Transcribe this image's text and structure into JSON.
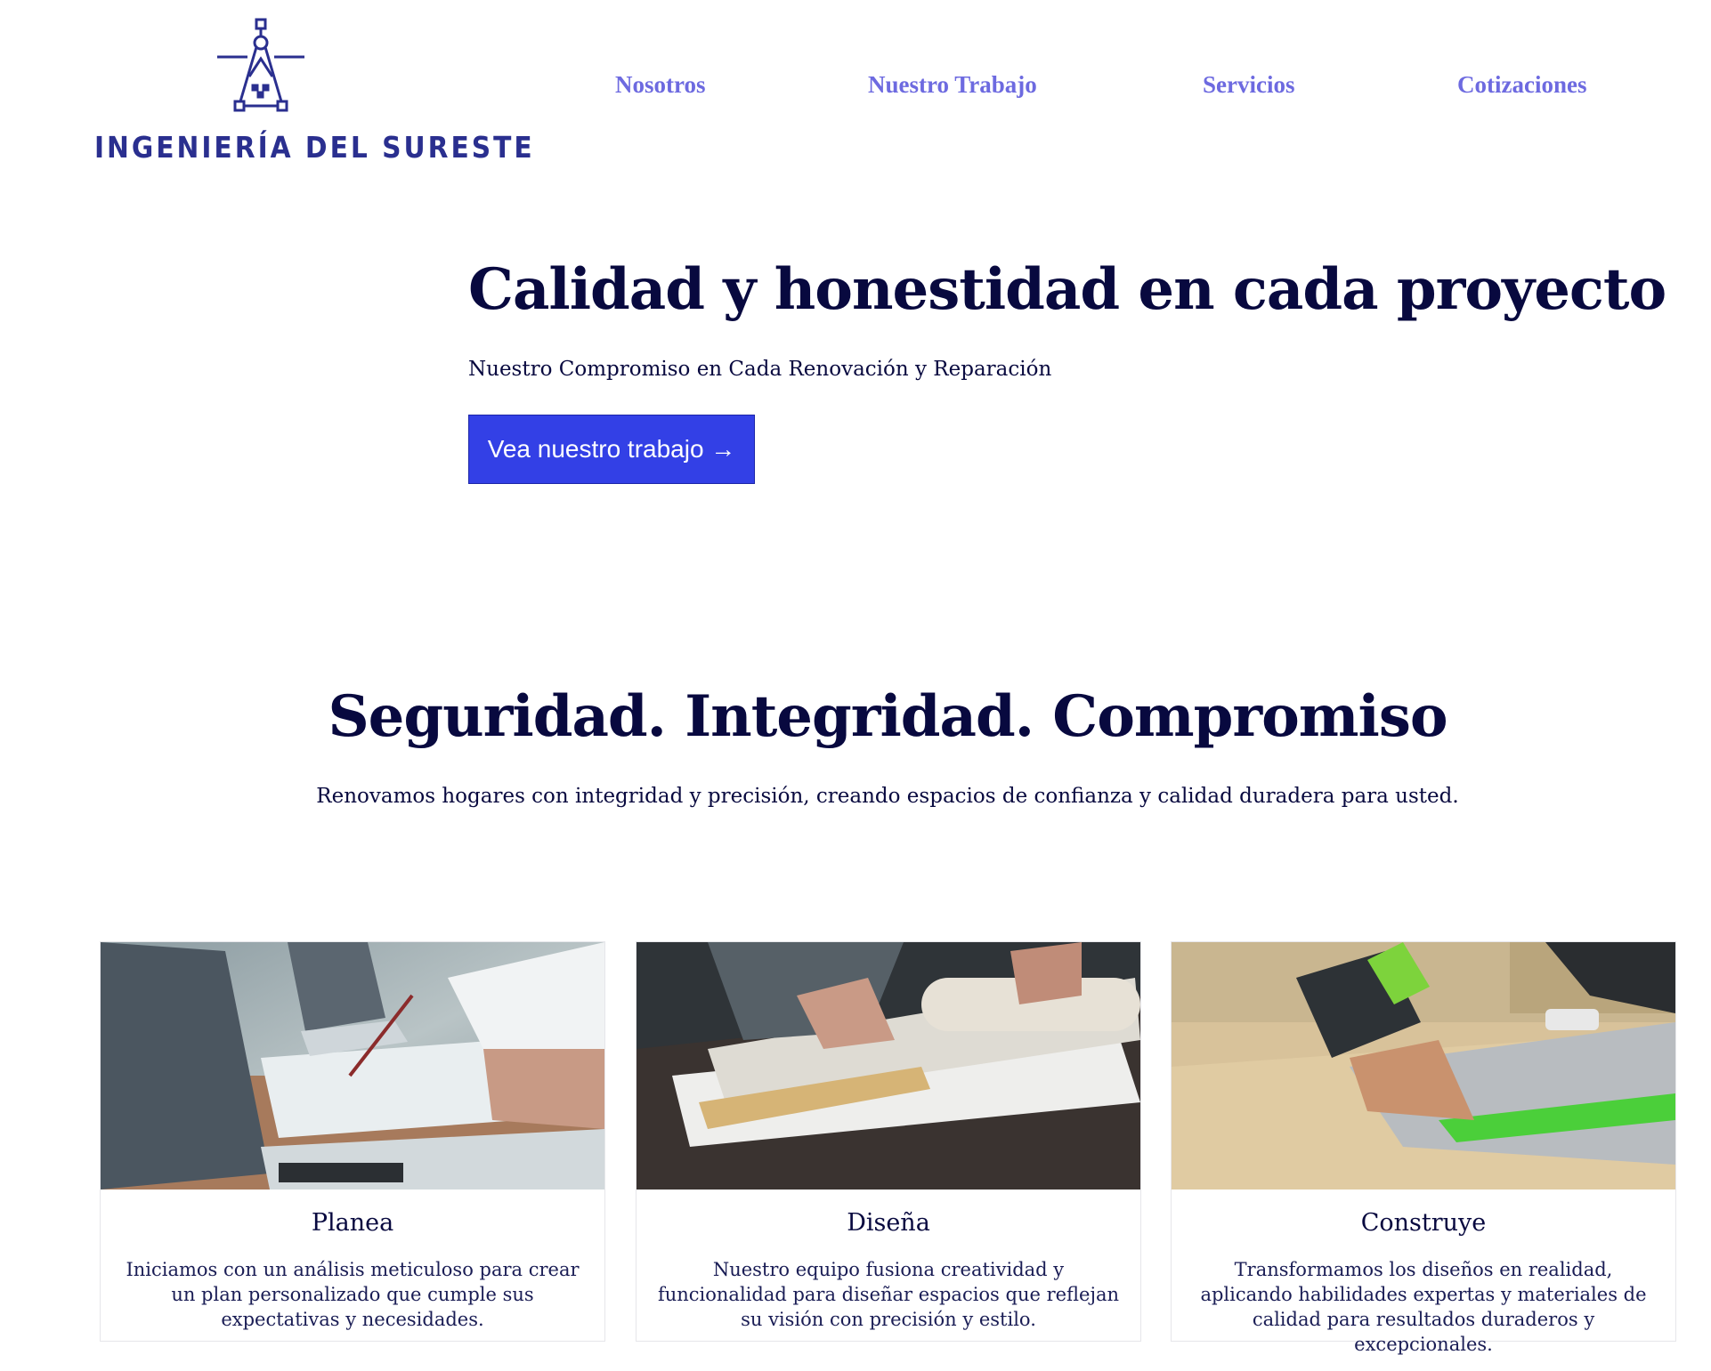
{
  "brand": {
    "name": "INGENIERÍA DEL SURESTE",
    "icon": "compass-building-icon",
    "color": "#2a2f8f"
  },
  "nav": {
    "items": [
      {
        "label": "Nosotros"
      },
      {
        "label": "Nuestro Trabajo"
      },
      {
        "label": "Servicios"
      },
      {
        "label": "Cotizaciones"
      }
    ],
    "color": "#6d6ae0"
  },
  "hero": {
    "title": "Calidad y honestidad en cada proyecto",
    "subtitle": "Nuestro Compromiso en Cada Renovación y Reparación",
    "button_label": "Vea nuestro trabajo →",
    "button_color": "#3340e6"
  },
  "values": {
    "title": "Seguridad. Integridad. Compromiso",
    "subtitle": "Renovamos hogares con integridad y precisión, creando espacios de confianza y calidad duradera para usted."
  },
  "cards": [
    {
      "title": "Planea",
      "text": "Iniciamos con un análisis meticuloso para crear un plan personalizado que cumple sus expectativas y necesidades.",
      "image": "planning-laptops-photo"
    },
    {
      "title": "Diseña",
      "text": "Nuestro equipo fusiona creatividad y funcionalidad para diseñar espacios que reflejan su visión con precisión y estilo.",
      "image": "drafting-ruler-photo"
    },
    {
      "title": "Construye",
      "text": "Transformamos los diseños en realidad, aplicando habilidades expertas y materiales de calidad para resultados duraderos y excepcionales.",
      "image": "carpentry-saw-photo"
    }
  ],
  "colors": {
    "heading": "#08093f",
    "accent": "#3340e6"
  }
}
